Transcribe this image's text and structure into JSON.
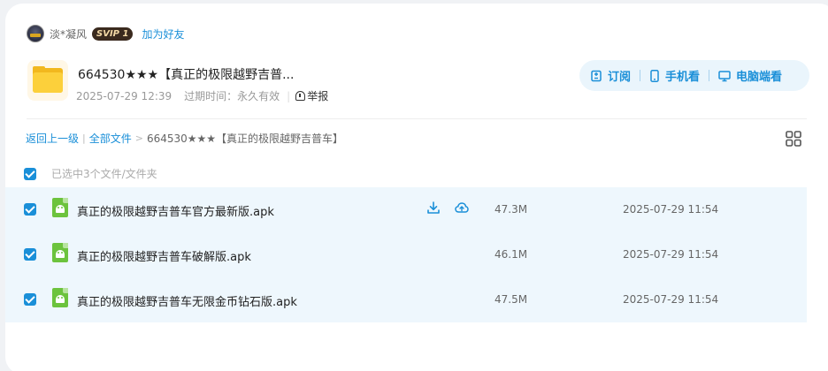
{
  "user": {
    "name": "淡*凝风",
    "vip_badge": "SVIP 1",
    "add_friend": "加为好友"
  },
  "share": {
    "title": "664530★★★【真正的极限越野吉普...",
    "date": "2025-07-29 12:39",
    "expire_label": "过期时间：永久有效",
    "report": "举报"
  },
  "actions": [
    {
      "label": "订阅",
      "icon": "subscribe-icon"
    },
    {
      "label": "手机看",
      "icon": "phone-icon"
    },
    {
      "label": "电脑端看",
      "icon": "desktop-icon"
    }
  ],
  "breadcrumb": {
    "back": "返回上一级",
    "sep": "|",
    "all_files": "全部文件",
    "arrow": ">",
    "current": "664530★★★【真正的极限越野吉普车】"
  },
  "selection": {
    "text": "已选中3个文件/文件夹"
  },
  "files": [
    {
      "name": "真正的极限越野吉普车官方最新版.apk",
      "size": "47.3M",
      "date": "2025-07-29 11:54",
      "checked": true,
      "show_tools": true
    },
    {
      "name": "真正的极限越野吉普车破解版.apk",
      "size": "46.1M",
      "date": "2025-07-29 11:54",
      "checked": true,
      "show_tools": false
    },
    {
      "name": "真正的极限越野吉普车无限金币钻石版.apk",
      "size": "47.5M",
      "date": "2025-07-29 11:54",
      "checked": true,
      "show_tools": false
    }
  ],
  "colors": {
    "accent": "#1a8fd8",
    "row_highlight": "#eef7fd",
    "folder": "#fcd03b",
    "apk": "#6cc33d"
  }
}
